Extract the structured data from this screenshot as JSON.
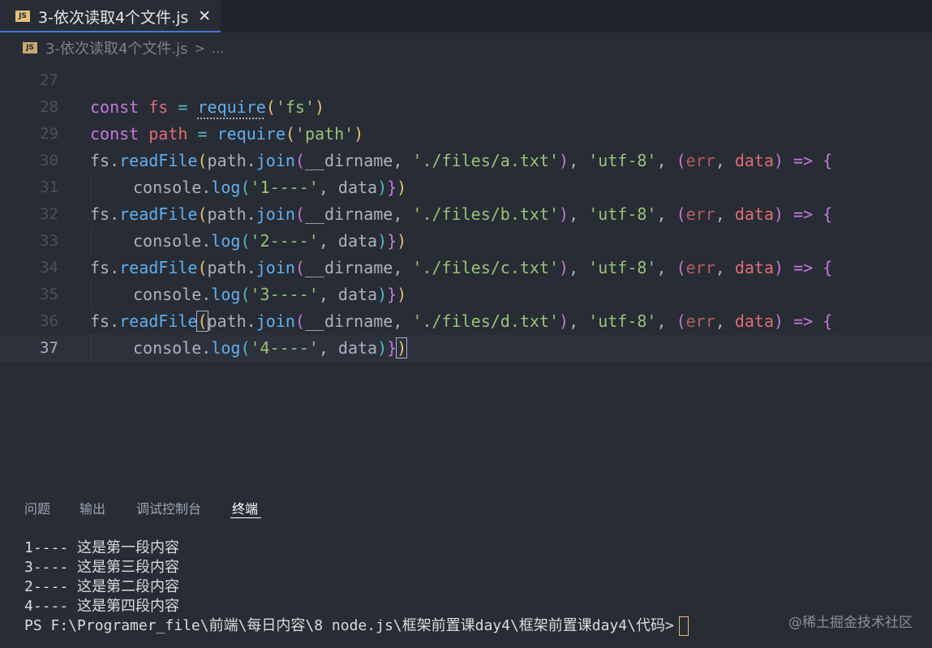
{
  "tab": {
    "icon_label": "JS",
    "title": "3-依次读取4个文件.js",
    "close": "✕"
  },
  "breadcrumb": {
    "icon_label": "JS",
    "file": "3-依次读取4个文件.js",
    "sep": ">",
    "more": "..."
  },
  "code_lines": [
    {
      "num": "27",
      "tokens": []
    },
    {
      "num": "28",
      "tokens": [
        {
          "t": "const",
          "c": "kw"
        },
        {
          "t": " ",
          "c": "txt"
        },
        {
          "t": "fs",
          "c": "var"
        },
        {
          "t": " ",
          "c": "txt"
        },
        {
          "t": "=",
          "c": "p3"
        },
        {
          "t": " ",
          "c": "txt"
        },
        {
          "t": "require",
          "c": "fn req"
        },
        {
          "t": "(",
          "c": "p1"
        },
        {
          "t": "'fs'",
          "c": "str"
        },
        {
          "t": ")",
          "c": "p1"
        }
      ]
    },
    {
      "num": "29",
      "tokens": [
        {
          "t": "const",
          "c": "kw"
        },
        {
          "t": " ",
          "c": "txt"
        },
        {
          "t": "path",
          "c": "var"
        },
        {
          "t": " ",
          "c": "txt"
        },
        {
          "t": "=",
          "c": "p3"
        },
        {
          "t": " ",
          "c": "txt"
        },
        {
          "t": "require",
          "c": "fn"
        },
        {
          "t": "(",
          "c": "p1"
        },
        {
          "t": "'path'",
          "c": "str"
        },
        {
          "t": ")",
          "c": "p1"
        }
      ]
    },
    {
      "num": "30",
      "tokens": [
        {
          "t": "fs",
          "c": "txt"
        },
        {
          "t": ".",
          "c": "txt"
        },
        {
          "t": "readFile",
          "c": "fn"
        },
        {
          "t": "(",
          "c": "p1"
        },
        {
          "t": "path",
          "c": "txt"
        },
        {
          "t": ".",
          "c": "txt"
        },
        {
          "t": "join",
          "c": "fn"
        },
        {
          "t": "(",
          "c": "p2"
        },
        {
          "t": "__dirname",
          "c": "txt"
        },
        {
          "t": ", ",
          "c": "txt"
        },
        {
          "t": "'./files/a.txt'",
          "c": "str"
        },
        {
          "t": ")",
          "c": "p2"
        },
        {
          "t": ", ",
          "c": "txt"
        },
        {
          "t": "'utf-8'",
          "c": "str"
        },
        {
          "t": ", ",
          "c": "txt"
        },
        {
          "t": "(",
          "c": "p2"
        },
        {
          "t": "err",
          "c": "pm"
        },
        {
          "t": ", ",
          "c": "txt"
        },
        {
          "t": "data",
          "c": "var"
        },
        {
          "t": ")",
          "c": "p2"
        },
        {
          "t": " ",
          "c": "txt"
        },
        {
          "t": "=>",
          "c": "kw"
        },
        {
          "t": " ",
          "c": "txt"
        },
        {
          "t": "{",
          "c": "p2"
        }
      ]
    },
    {
      "num": "31",
      "indent": true,
      "tokens": [
        {
          "t": "console",
          "c": "txt"
        },
        {
          "t": ".",
          "c": "txt"
        },
        {
          "t": "log",
          "c": "fn"
        },
        {
          "t": "(",
          "c": "p3"
        },
        {
          "t": "'1----'",
          "c": "str"
        },
        {
          "t": ", ",
          "c": "txt"
        },
        {
          "t": "data",
          "c": "txt"
        },
        {
          "t": ")",
          "c": "p3"
        },
        {
          "t": "}",
          "c": "p2"
        },
        {
          "t": ")",
          "c": "p1"
        }
      ]
    },
    {
      "num": "32",
      "tokens": [
        {
          "t": "fs",
          "c": "txt"
        },
        {
          "t": ".",
          "c": "txt"
        },
        {
          "t": "readFile",
          "c": "fn"
        },
        {
          "t": "(",
          "c": "p1"
        },
        {
          "t": "path",
          "c": "txt"
        },
        {
          "t": ".",
          "c": "txt"
        },
        {
          "t": "join",
          "c": "fn"
        },
        {
          "t": "(",
          "c": "p2"
        },
        {
          "t": "__dirname",
          "c": "txt"
        },
        {
          "t": ", ",
          "c": "txt"
        },
        {
          "t": "'./files/b.txt'",
          "c": "str"
        },
        {
          "t": ")",
          "c": "p2"
        },
        {
          "t": ", ",
          "c": "txt"
        },
        {
          "t": "'utf-8'",
          "c": "str"
        },
        {
          "t": ", ",
          "c": "txt"
        },
        {
          "t": "(",
          "c": "p2"
        },
        {
          "t": "err",
          "c": "pm"
        },
        {
          "t": ", ",
          "c": "txt"
        },
        {
          "t": "data",
          "c": "var"
        },
        {
          "t": ")",
          "c": "p2"
        },
        {
          "t": " ",
          "c": "txt"
        },
        {
          "t": "=>",
          "c": "kw"
        },
        {
          "t": " ",
          "c": "txt"
        },
        {
          "t": "{",
          "c": "p2"
        }
      ]
    },
    {
      "num": "33",
      "indent": true,
      "tokens": [
        {
          "t": "console",
          "c": "txt"
        },
        {
          "t": ".",
          "c": "txt"
        },
        {
          "t": "log",
          "c": "fn"
        },
        {
          "t": "(",
          "c": "p3"
        },
        {
          "t": "'2----'",
          "c": "str"
        },
        {
          "t": ", ",
          "c": "txt"
        },
        {
          "t": "data",
          "c": "txt"
        },
        {
          "t": ")",
          "c": "p3"
        },
        {
          "t": "}",
          "c": "p2"
        },
        {
          "t": ")",
          "c": "p1"
        }
      ]
    },
    {
      "num": "34",
      "tokens": [
        {
          "t": "fs",
          "c": "txt"
        },
        {
          "t": ".",
          "c": "txt"
        },
        {
          "t": "readFile",
          "c": "fn"
        },
        {
          "t": "(",
          "c": "p1"
        },
        {
          "t": "path",
          "c": "txt"
        },
        {
          "t": ".",
          "c": "txt"
        },
        {
          "t": "join",
          "c": "fn"
        },
        {
          "t": "(",
          "c": "p2"
        },
        {
          "t": "__dirname",
          "c": "txt"
        },
        {
          "t": ", ",
          "c": "txt"
        },
        {
          "t": "'./files/c.txt'",
          "c": "str"
        },
        {
          "t": ")",
          "c": "p2"
        },
        {
          "t": ", ",
          "c": "txt"
        },
        {
          "t": "'utf-8'",
          "c": "str"
        },
        {
          "t": ", ",
          "c": "txt"
        },
        {
          "t": "(",
          "c": "p2"
        },
        {
          "t": "err",
          "c": "pm"
        },
        {
          "t": ", ",
          "c": "txt"
        },
        {
          "t": "data",
          "c": "var"
        },
        {
          "t": ")",
          "c": "p2"
        },
        {
          "t": " ",
          "c": "txt"
        },
        {
          "t": "=>",
          "c": "kw"
        },
        {
          "t": " ",
          "c": "txt"
        },
        {
          "t": "{",
          "c": "p2"
        }
      ]
    },
    {
      "num": "35",
      "indent": true,
      "tokens": [
        {
          "t": "console",
          "c": "txt"
        },
        {
          "t": ".",
          "c": "txt"
        },
        {
          "t": "log",
          "c": "fn"
        },
        {
          "t": "(",
          "c": "p3"
        },
        {
          "t": "'3----'",
          "c": "str"
        },
        {
          "t": ", ",
          "c": "txt"
        },
        {
          "t": "data",
          "c": "txt"
        },
        {
          "t": ")",
          "c": "p3"
        },
        {
          "t": "}",
          "c": "p2"
        },
        {
          "t": ")",
          "c": "p1"
        }
      ]
    },
    {
      "num": "36",
      "tokens": [
        {
          "t": "fs",
          "c": "txt"
        },
        {
          "t": ".",
          "c": "txt"
        },
        {
          "t": "readFile",
          "c": "fn"
        },
        {
          "t": "(",
          "c": "p1 cursor-box"
        },
        {
          "t": "path",
          "c": "txt"
        },
        {
          "t": ".",
          "c": "txt"
        },
        {
          "t": "join",
          "c": "fn"
        },
        {
          "t": "(",
          "c": "p2"
        },
        {
          "t": "__dirname",
          "c": "txt"
        },
        {
          "t": ", ",
          "c": "txt"
        },
        {
          "t": "'./files/d.txt'",
          "c": "str"
        },
        {
          "t": ")",
          "c": "p2"
        },
        {
          "t": ", ",
          "c": "txt"
        },
        {
          "t": "'utf-8'",
          "c": "str"
        },
        {
          "t": ", ",
          "c": "txt"
        },
        {
          "t": "(",
          "c": "p2"
        },
        {
          "t": "err",
          "c": "pm"
        },
        {
          "t": ", ",
          "c": "txt"
        },
        {
          "t": "data",
          "c": "var"
        },
        {
          "t": ")",
          "c": "p2"
        },
        {
          "t": " ",
          "c": "txt"
        },
        {
          "t": "=>",
          "c": "kw"
        },
        {
          "t": " ",
          "c": "txt"
        },
        {
          "t": "{",
          "c": "p2"
        }
      ]
    },
    {
      "num": "37",
      "indent": true,
      "active": true,
      "tokens": [
        {
          "t": "console",
          "c": "txt"
        },
        {
          "t": ".",
          "c": "txt"
        },
        {
          "t": "log",
          "c": "fn"
        },
        {
          "t": "(",
          "c": "p3"
        },
        {
          "t": "'4----'",
          "c": "str"
        },
        {
          "t": ", ",
          "c": "txt"
        },
        {
          "t": "data",
          "c": "txt"
        },
        {
          "t": ")",
          "c": "p3"
        },
        {
          "t": "}",
          "c": "p2"
        },
        {
          "t": ")",
          "c": "p1 cursor-box"
        }
      ]
    }
  ],
  "panel": {
    "tabs": [
      {
        "label": "问题",
        "active": false
      },
      {
        "label": "输出",
        "active": false
      },
      {
        "label": "调试控制台",
        "active": false
      },
      {
        "label": "终端",
        "active": true
      }
    ]
  },
  "terminal": {
    "lines": [
      "1---- 这是第一段内容",
      "3---- 这是第三段内容",
      "2---- 这是第二段内容",
      "4---- 这是第四段内容"
    ],
    "prompt": "PS F:\\Programer_file\\前端\\每日内容\\8 node.js\\框架前置课day4\\框架前置课day4\\代码>"
  },
  "watermark": "@稀土掘金技术社区",
  "colors": {
    "background": "#282c34",
    "keyword": "#c678dd",
    "variable": "#e06c75",
    "function": "#61afef",
    "string": "#98c379",
    "bracket": "#e5c07b"
  }
}
